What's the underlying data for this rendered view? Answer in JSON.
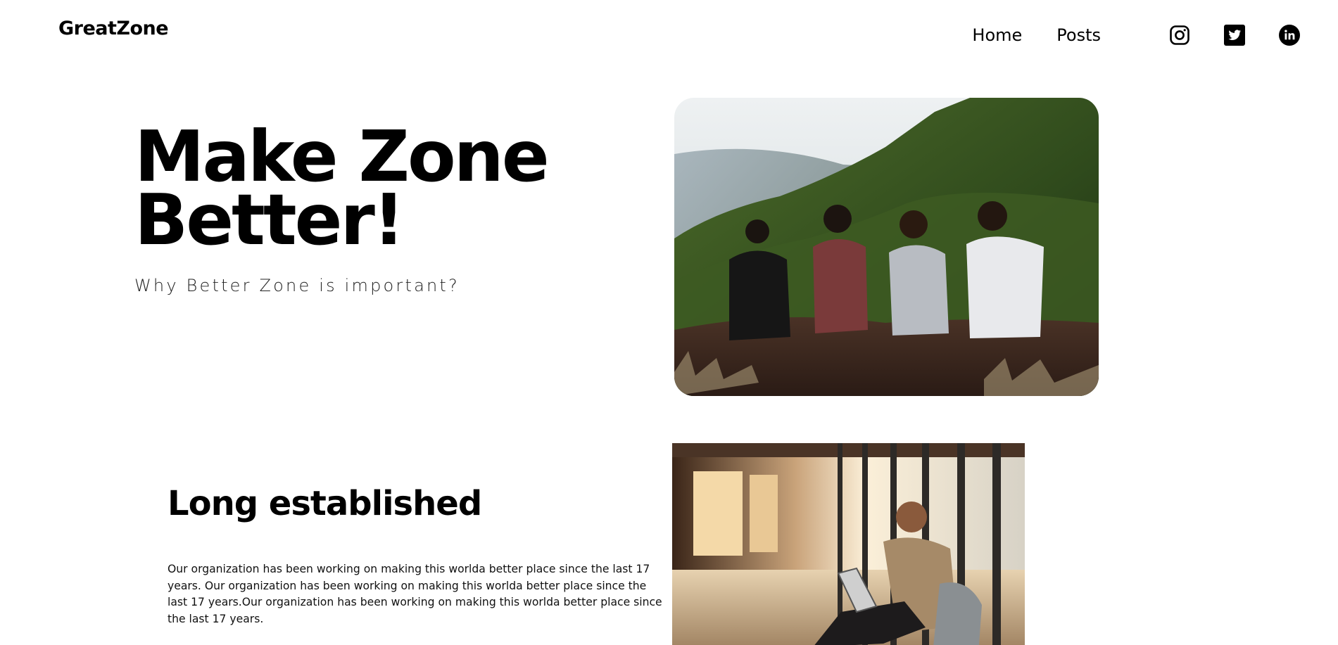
{
  "header": {
    "brand": "GreatZone",
    "nav": [
      {
        "label": "Home"
      },
      {
        "label": "Posts"
      }
    ],
    "social": [
      "instagram-icon",
      "twitter-icon",
      "linkedin-icon"
    ]
  },
  "hero": {
    "title": "Make Zone Better!",
    "subtitle": "Why Better Zone is important?"
  },
  "section": {
    "title": "Long established",
    "body": "Our organization has been working on making this worlda better place since the last 17 years. Our organization has been working on making this worlda better place since the last 17 years.Our organization has been working on making this worlda better place since the last 17 years."
  },
  "colors": {
    "background": "#ffffff",
    "text": "#000000"
  }
}
